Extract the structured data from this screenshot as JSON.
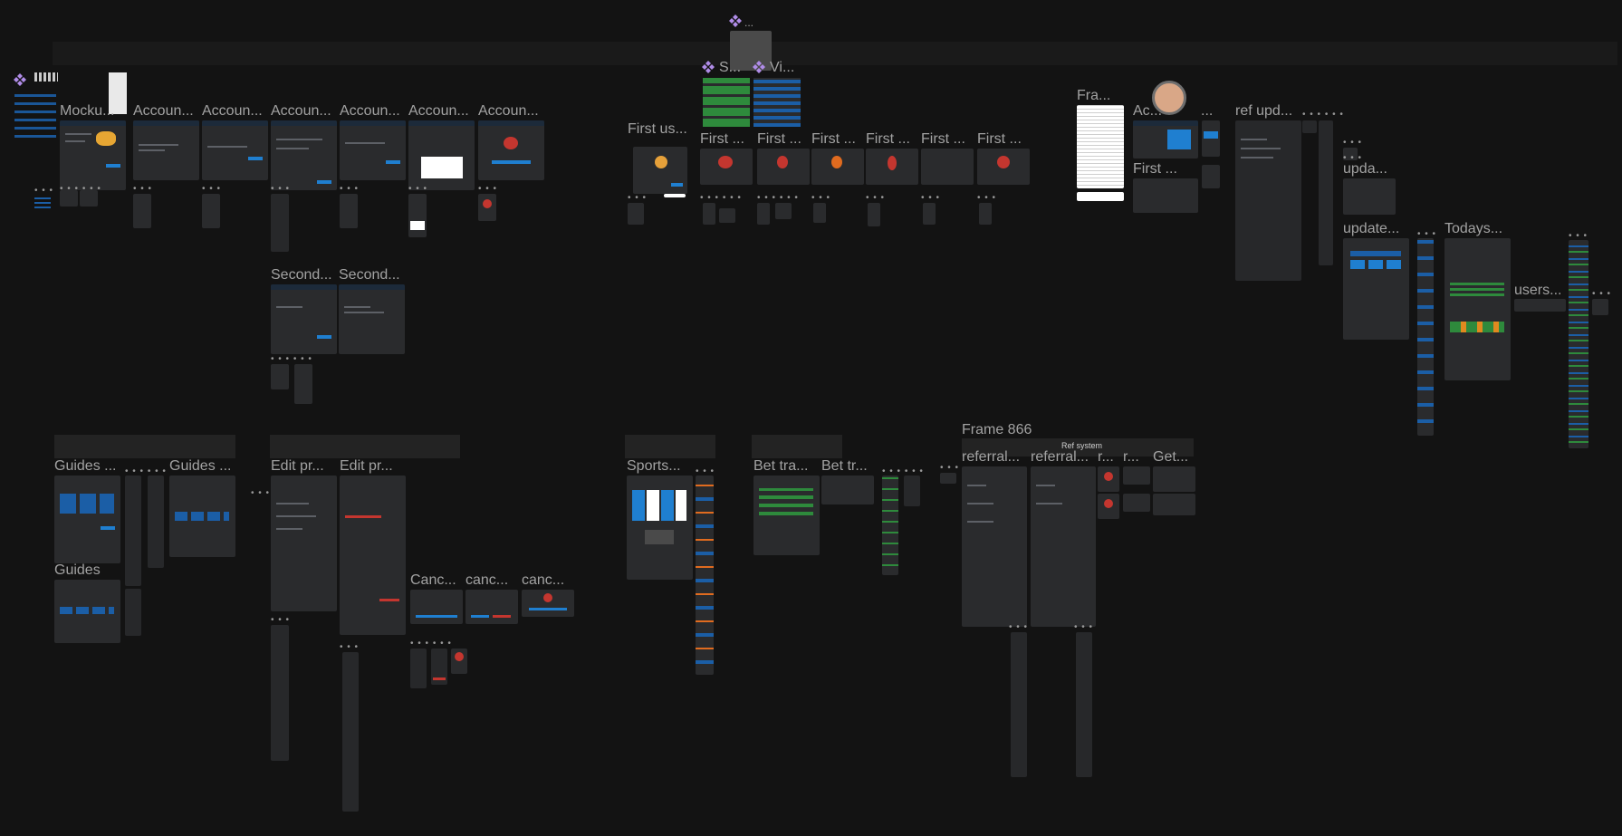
{
  "canvas": {
    "background": "#131313",
    "accent": "#1f7fd0"
  },
  "labels": {
    "mockup": "Mocku...",
    "account_1": "Accoun...",
    "account_2": "Accoun...",
    "account_3": "Accoun...",
    "account_4": "Accoun...",
    "account_5": "Accoun...",
    "account_6": "Accoun...",
    "second_1": "Second...",
    "second_2": "Second...",
    "first_us": "First us...",
    "first_1": "First ...",
    "first_2": "First ...",
    "first_3": "First ...",
    "first_4": "First ...",
    "first_5": "First ...",
    "first_6": "First ...",
    "component_s": "S...",
    "component_vi": "Vi...",
    "component_top": "...",
    "fra": "Fra...",
    "ac": "Ac...",
    "ac_dots": "...",
    "first_right": "First ...",
    "ref_upd": "ref upd...",
    "upda": "upda...",
    "update": "update...",
    "todays": "Todays...",
    "users": "users...",
    "guides_1": "Guides ...",
    "guides_2": "Guides ...",
    "guides_3": "Guides",
    "edit_pr_1": "Edit pr...",
    "edit_pr_2": "Edit pr...",
    "canc_1": "Canc...",
    "canc_2": "canc...",
    "canc_3": "canc...",
    "sports": "Sports...",
    "bet_tra": "Bet tra...",
    "bet_tr": "Bet tr...",
    "frame_866": "Frame 866",
    "ref_system": "Ref system",
    "referral_1": "referral...",
    "referral_2": "referral...",
    "r_1": "r...",
    "r_2": "r...",
    "get": "Get..."
  },
  "icons": {
    "component": "component-icon",
    "avatar": "user-avatar"
  }
}
